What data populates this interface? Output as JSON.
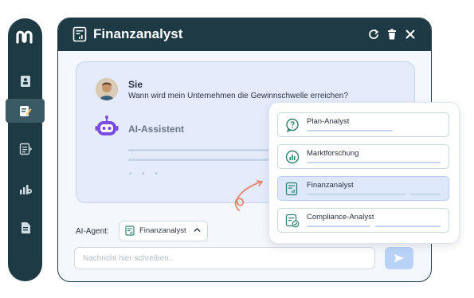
{
  "sidebar": {
    "logo": "brand-logo",
    "items": [
      {
        "icon": "contact-book-icon"
      },
      {
        "icon": "edit-document-icon",
        "active": true
      },
      {
        "icon": "document-lines-icon"
      },
      {
        "icon": "growth-chart-icon"
      },
      {
        "icon": "file-icon"
      }
    ]
  },
  "window": {
    "title": "Finanzanalyst",
    "title_icon": "finance-report-icon",
    "controls": [
      "refresh-icon",
      "trash-icon",
      "close-icon"
    ]
  },
  "chat": {
    "user_name": "Sie",
    "user_message": "Wann wird mein Unternehmen die Gewinnschwelle erreichen?",
    "assistant_name": "AI-Assistent",
    "typing_indicator": "• • •"
  },
  "agent_selector": {
    "label": "AI-Agent:",
    "selected": "Finanzanalyst"
  },
  "composer": {
    "placeholder": "Nachricht hier schreiben.."
  },
  "agents": [
    {
      "name": "Plan-Analyst",
      "icon": "chat-question-icon",
      "selected": false
    },
    {
      "name": "Marktforschung",
      "icon": "chart-bars-icon",
      "selected": false
    },
    {
      "name": "Finanzanalyst",
      "icon": "finance-report-icon",
      "selected": true
    },
    {
      "name": "Compliance-Analyst",
      "icon": "document-check-icon",
      "selected": false
    }
  ],
  "colors": {
    "navy": "#1d3a45",
    "accent_green": "#2f7d6d",
    "bot_purple": "#7a4ce0",
    "arrow_coral": "#e8836f",
    "chat_bg": "#e4ecfb",
    "send_button": "#b8d3f7"
  }
}
